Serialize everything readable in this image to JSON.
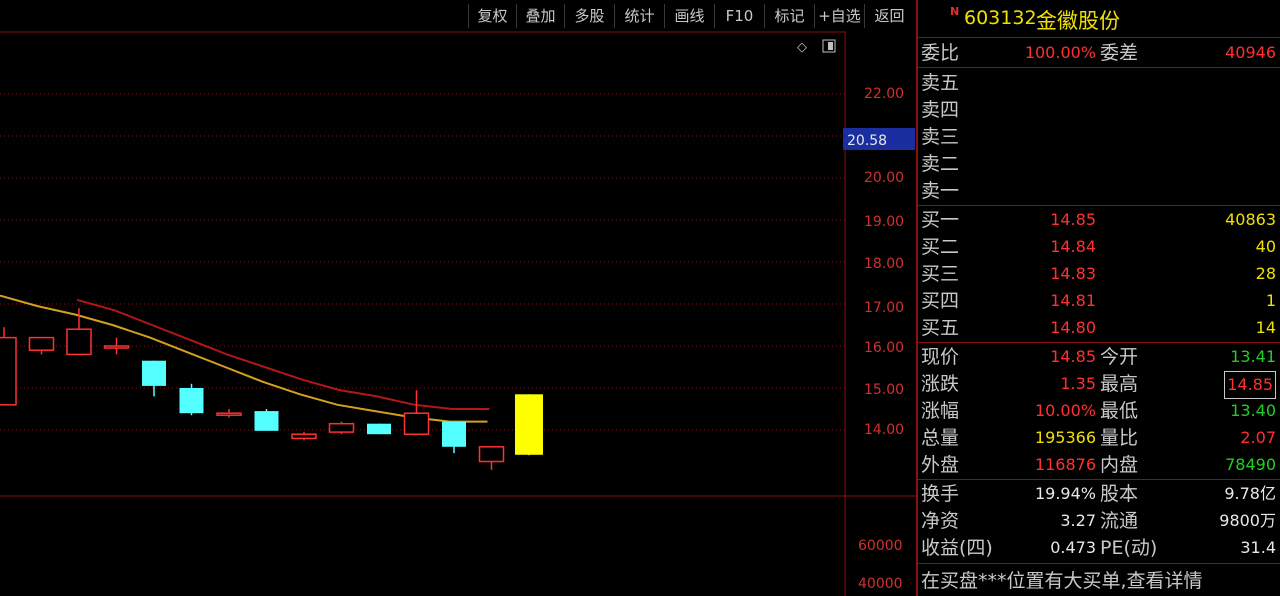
{
  "toolbar": {
    "buttons": [
      "复权",
      "叠加",
      "多股",
      "统计",
      "画线",
      "F10",
      "标记",
      "+自选",
      "返回"
    ]
  },
  "chart": {
    "price_ticks": [
      "22.00",
      "20.00",
      "19.00",
      "18.00",
      "17.00",
      "16.00",
      "15.00",
      "14.00"
    ],
    "current_price_tag": "20.58",
    "volume_ticks": [
      "60000",
      "40000"
    ]
  },
  "chart_data": {
    "type": "candlestick",
    "ylim": [
      13.0,
      23.0
    ],
    "candles": [
      {
        "open": 14.6,
        "close": 16.2,
        "high": 16.45,
        "low": 16.0
      },
      {
        "open": 15.9,
        "close": 16.2,
        "high": 16.2,
        "low": 15.8
      },
      {
        "open": 15.8,
        "close": 16.4,
        "high": 16.9,
        "low": 15.8
      },
      {
        "open": 16.0,
        "close": 16.0,
        "high": 16.2,
        "low": 15.8
      },
      {
        "open": 15.65,
        "close": 15.05,
        "high": 15.65,
        "low": 14.8
      },
      {
        "open": 15.0,
        "close": 14.4,
        "high": 15.1,
        "low": 14.35
      },
      {
        "open": 14.4,
        "close": 14.4,
        "high": 14.5,
        "low": 14.3
      },
      {
        "open": 14.45,
        "close": 13.98,
        "high": 14.5,
        "low": 13.98
      },
      {
        "open": 13.8,
        "close": 13.9,
        "high": 13.95,
        "low": 13.75
      },
      {
        "open": 13.95,
        "close": 14.15,
        "high": 14.2,
        "low": 13.9
      },
      {
        "open": 14.15,
        "close": 13.9,
        "high": 14.15,
        "low": 13.9
      },
      {
        "open": 13.9,
        "close": 14.4,
        "high": 14.95,
        "low": 13.9
      },
      {
        "open": 14.2,
        "close": 13.6,
        "high": 14.2,
        "low": 13.45
      },
      {
        "open": 13.25,
        "close": 13.6,
        "high": 13.6,
        "low": 13.05
      },
      {
        "open": 13.41,
        "close": 14.85,
        "high": 14.85,
        "low": 13.4
      }
    ],
    "ma_yellow": [
      17.2,
      16.95,
      16.75,
      16.5,
      16.2,
      15.85,
      15.5,
      15.15,
      14.85,
      14.6,
      14.45,
      14.3,
      14.2,
      14.2
    ],
    "ma_red": [
      null,
      null,
      17.1,
      16.85,
      16.5,
      16.15,
      15.8,
      15.5,
      15.2,
      14.95,
      14.8,
      14.6,
      14.5,
      14.5
    ]
  },
  "stock": {
    "flag": "N",
    "code": "603132",
    "name": "金徽股份"
  },
  "order_summary": {
    "ratio_label": "委比",
    "ratio_value": "100.00%",
    "diff_label": "委差",
    "diff_value": "40946"
  },
  "asks": [
    {
      "label": "卖五",
      "price": "",
      "volume": ""
    },
    {
      "label": "卖四",
      "price": "",
      "volume": ""
    },
    {
      "label": "卖三",
      "price": "",
      "volume": ""
    },
    {
      "label": "卖二",
      "price": "",
      "volume": ""
    },
    {
      "label": "卖一",
      "price": "",
      "volume": ""
    }
  ],
  "bids": [
    {
      "label": "买一",
      "price": "14.85",
      "volume": "40863"
    },
    {
      "label": "买二",
      "price": "14.84",
      "volume": "40"
    },
    {
      "label": "买三",
      "price": "14.83",
      "volume": "28"
    },
    {
      "label": "买四",
      "price": "14.81",
      "volume": "1"
    },
    {
      "label": "买五",
      "price": "14.80",
      "volume": "14"
    }
  ],
  "quote": [
    {
      "l1": "现价",
      "v1": "14.85",
      "l2": "今开",
      "v2": "13.41"
    },
    {
      "l1": "涨跌",
      "v1": "1.35",
      "l2": "最高",
      "v2": "14.85"
    },
    {
      "l1": "涨幅",
      "v1": "10.00%",
      "l2": "最低",
      "v2": "13.40"
    },
    {
      "l1": "总量",
      "v1": "195366",
      "l2": "量比",
      "v2": "2.07"
    },
    {
      "l1": "外盘",
      "v1": "116876",
      "l2": "内盘",
      "v2": "78490"
    }
  ],
  "fundamentals": [
    {
      "l1": "换手",
      "v1": "19.94%",
      "l2": "股本",
      "v2": "9.78亿"
    },
    {
      "l1": "净资",
      "v1": "3.27",
      "l2": "流通",
      "v2": "9800万"
    },
    {
      "l1": "收益(四)",
      "v1": "0.473",
      "l2": "PE(动)",
      "v2": "31.4"
    }
  ],
  "hint": "在买盘***位置有大买单,查看详情",
  "colors": {
    "up": "#ff3030",
    "down": "#54ffff",
    "today": "#ffff00",
    "ma_yellow": "#d4a020",
    "ma_red": "#b01818",
    "grid": "#8a1010",
    "price_up": "#ff3030",
    "price_down": "#20d020",
    "volume": "#f0e000"
  }
}
